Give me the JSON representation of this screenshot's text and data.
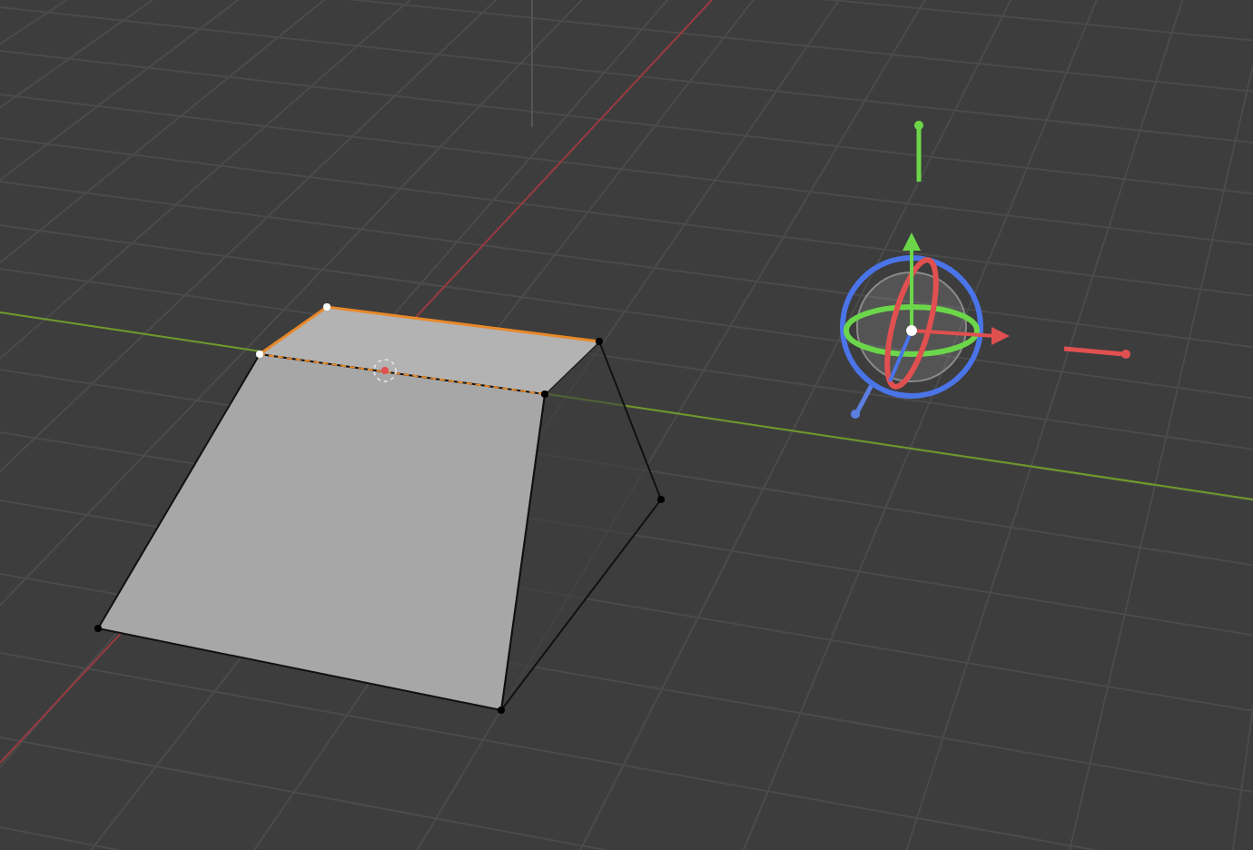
{
  "viewport": {
    "mesh": {
      "edge_selected": true
    },
    "gizmo": {
      "shown": true
    }
  }
}
